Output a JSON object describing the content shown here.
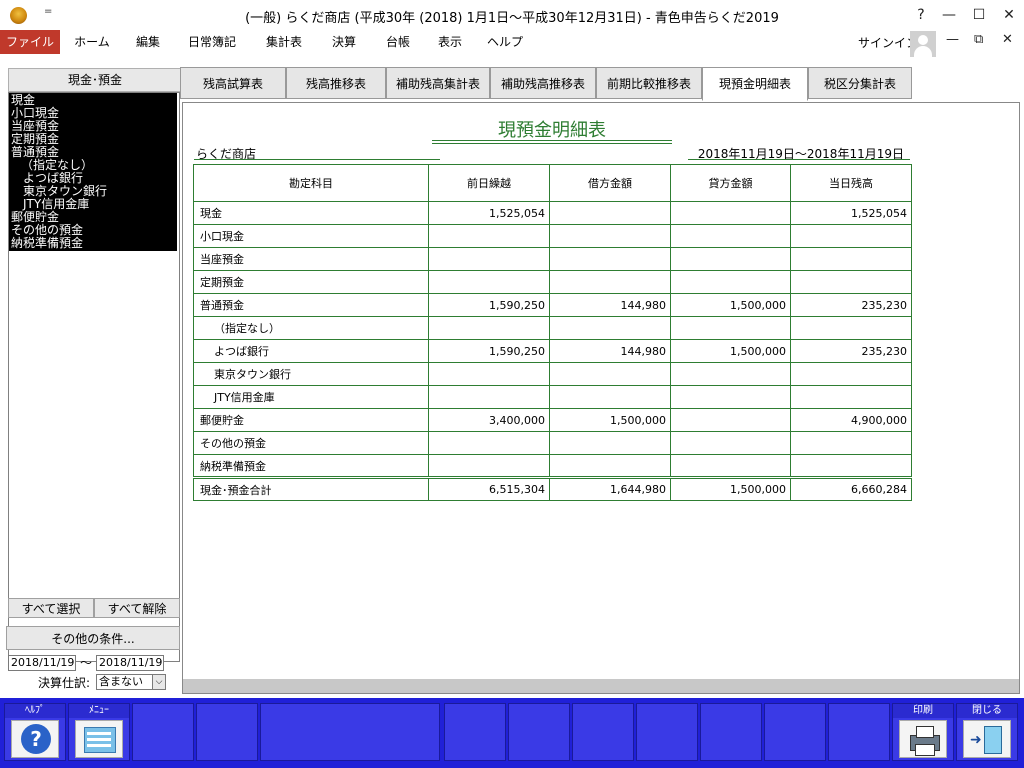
{
  "window": {
    "title": "(一般) らくだ商店 (平成30年 (2018) 1月1日～平成30年12月31日) - 青色申告らくだ2019",
    "quick_access": "=",
    "help": "?",
    "minimize": "—",
    "maximize": "☐",
    "close": "✕"
  },
  "menu": {
    "items": [
      "ファイル",
      "ホーム",
      "編集",
      "日常簿記",
      "集計表",
      "決算",
      "台帳",
      "表示",
      "ヘルプ"
    ],
    "signin": "サインイン",
    "min": "—",
    "restore": "⧉",
    "close": "✕"
  },
  "left_panel": {
    "header": "現金･預金",
    "items": [
      "現金",
      "小口現金",
      "当座預金",
      "定期預金",
      "普通預金",
      "（指定なし）",
      "よつば銀行",
      "東京タウン銀行",
      "JTY信用金庫",
      "郵便貯金",
      "その他の預金",
      "納税準備預金"
    ],
    "select_all": "すべて選択",
    "deselect_all": "すべて解除",
    "other_conditions": "その他の条件...",
    "date_from": "2018/11/19",
    "tilde": "～",
    "date_to": "2018/11/19",
    "closing_label": "決算仕訳:",
    "closing_value": "含まない"
  },
  "tabs": [
    "残高試算表",
    "残高推移表",
    "補助残高集計表",
    "補助残高推移表",
    "前期比較推移表",
    "現預金明細表",
    "税区分集計表"
  ],
  "active_tab": 5,
  "report": {
    "title": "現預金明細表",
    "company": "らくだ商店",
    "period": "2018年11月19日～2018年11月19日",
    "columns": [
      "勘定科目",
      "前日繰越",
      "借方金額",
      "貸方金額",
      "当日残高"
    ],
    "rows": [
      {
        "account": "現金",
        "sub": false,
        "prev": "1,525,054",
        "debit": "",
        "credit": "",
        "balance": "1,525,054"
      },
      {
        "account": "小口現金",
        "sub": false,
        "prev": "",
        "debit": "",
        "credit": "",
        "balance": ""
      },
      {
        "account": "当座預金",
        "sub": false,
        "prev": "",
        "debit": "",
        "credit": "",
        "balance": ""
      },
      {
        "account": "定期預金",
        "sub": false,
        "prev": "",
        "debit": "",
        "credit": "",
        "balance": ""
      },
      {
        "account": "普通預金",
        "sub": false,
        "prev": "1,590,250",
        "debit": "144,980",
        "credit": "1,500,000",
        "balance": "235,230"
      },
      {
        "account": "（指定なし）",
        "sub": true,
        "prev": "",
        "debit": "",
        "credit": "",
        "balance": ""
      },
      {
        "account": "よつば銀行",
        "sub": true,
        "prev": "1,590,250",
        "debit": "144,980",
        "credit": "1,500,000",
        "balance": "235,230"
      },
      {
        "account": "東京タウン銀行",
        "sub": true,
        "prev": "",
        "debit": "",
        "credit": "",
        "balance": ""
      },
      {
        "account": "JTY信用金庫",
        "sub": true,
        "prev": "",
        "debit": "",
        "credit": "",
        "balance": ""
      },
      {
        "account": "郵便貯金",
        "sub": false,
        "prev": "3,400,000",
        "debit": "1,500,000",
        "credit": "",
        "balance": "4,900,000"
      },
      {
        "account": "その他の預金",
        "sub": false,
        "prev": "",
        "debit": "",
        "credit": "",
        "balance": ""
      },
      {
        "account": "納税準備預金",
        "sub": false,
        "prev": "",
        "debit": "",
        "credit": "",
        "balance": ""
      }
    ],
    "total": {
      "account": "現金･預金合計",
      "prev": "6,515,304",
      "debit": "1,644,980",
      "credit": "1,500,000",
      "balance": "6,660,284"
    }
  },
  "fkeys": {
    "help": "ﾍﾙﾌﾟ",
    "help_icon": "?",
    "menu": "ﾒﾆｭｰ",
    "print": "印刷",
    "close": "閉じる"
  },
  "colors": {
    "file_menu": "#c0392b",
    "report_green": "#2e7d32",
    "fkey_bar": "#2020d8"
  }
}
